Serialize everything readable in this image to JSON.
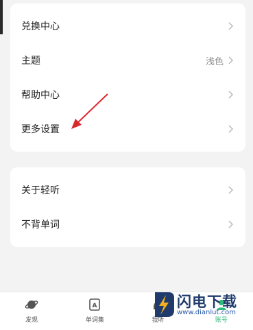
{
  "settings_group_1": {
    "items": [
      {
        "label": "兑换中心",
        "value": ""
      },
      {
        "label": "主题",
        "value": "浅色"
      },
      {
        "label": "帮助中心",
        "value": ""
      },
      {
        "label": "更多设置",
        "value": ""
      }
    ]
  },
  "settings_group_2": {
    "items": [
      {
        "label": "关于轻听",
        "value": ""
      },
      {
        "label": "不背单词",
        "value": ""
      }
    ]
  },
  "tabbar": {
    "tabs": [
      {
        "label": "发现",
        "icon": "planet-icon"
      },
      {
        "label": "单词集",
        "icon": "word-book-icon"
      },
      {
        "label": "我听",
        "icon": "headphone-icon"
      },
      {
        "label": "账号",
        "icon": "account-icon"
      }
    ],
    "active_color": "#2dbb7a"
  },
  "annotation": {
    "color": "#d9272e"
  },
  "watermark": {
    "brand": "闪电下载",
    "url": "www.dianlut.com"
  }
}
